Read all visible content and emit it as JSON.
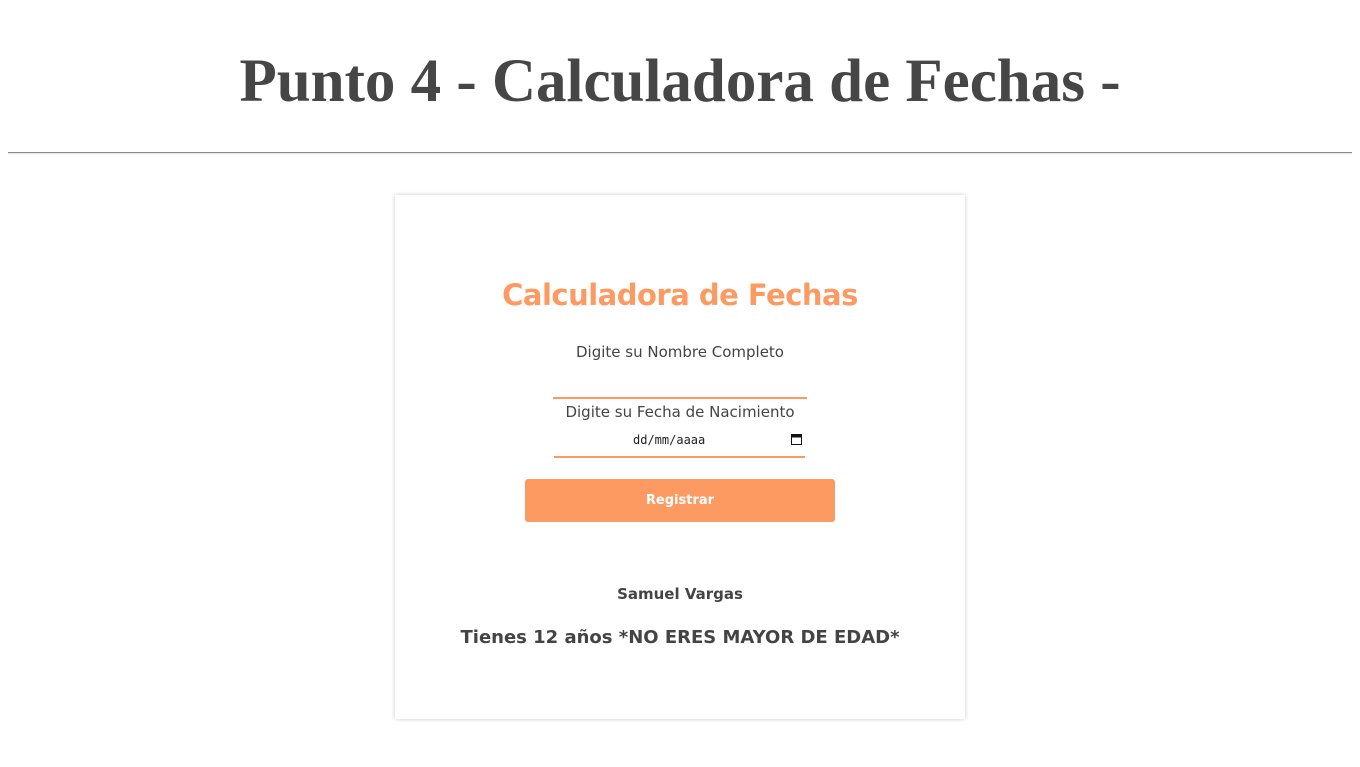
{
  "page": {
    "heading": "Punto 4 - Calculadora de Fechas -"
  },
  "form": {
    "title": "Calculadora de Fechas",
    "name_label": "Digite su Nombre Completo",
    "name_value": "",
    "date_label": "Digite su Fecha de Nacimiento",
    "date_placeholder": "dd/mm/aaaa",
    "submit_label": "Registrar"
  },
  "result": {
    "name": "Samuel Vargas",
    "message": "Tienes 12 años *NO ERES MAYOR DE EDAD*"
  },
  "icons": {
    "date_picker": "calendar-icon"
  },
  "colors": {
    "accent": "#fd9a62",
    "heading_text": "#464646",
    "body_text": "#444444",
    "button_text": "#ffffff"
  }
}
